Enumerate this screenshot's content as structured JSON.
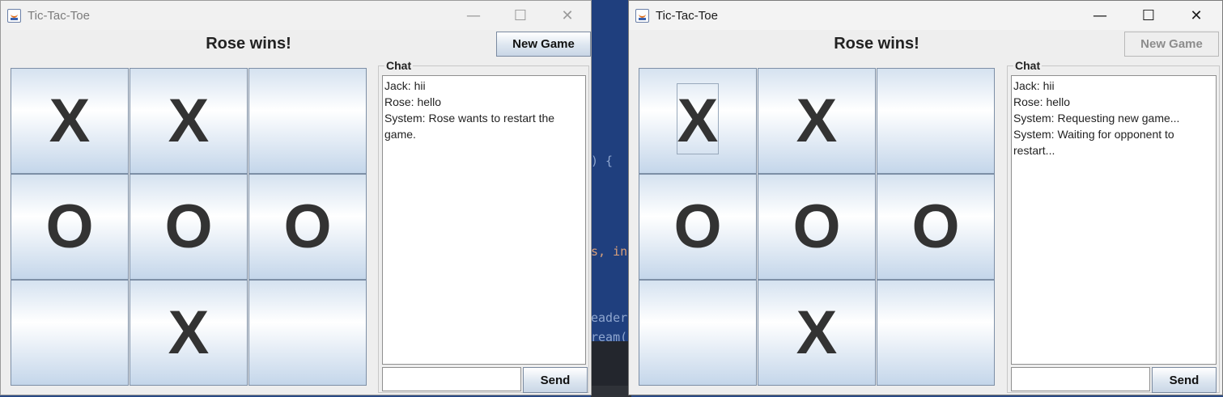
{
  "background_code": {
    "fragments": [
      ") { ",
      "s, in",
      "eader",
      "ream("
    ]
  },
  "windows": [
    {
      "title": "Tic-Tac-Toe",
      "status": "Rose wins!",
      "new_game_label": "New Game",
      "new_game_enabled": true,
      "board": [
        "X",
        "X",
        "",
        "O",
        "O",
        "O",
        "",
        "X",
        ""
      ],
      "chat_title": "Chat",
      "messages": [
        "Jack: hii",
        "Rose: hello",
        "System: Rose wants to restart the game."
      ],
      "input_value": "",
      "send_label": "Send",
      "controls": {
        "minimize": "—",
        "maximize": "☐",
        "close": "✕"
      }
    },
    {
      "title": "Tic-Tac-Toe",
      "status": "Rose wins!",
      "new_game_label": "New Game",
      "new_game_enabled": false,
      "board": [
        "X",
        "X",
        "",
        "O",
        "O",
        "O",
        "",
        "X",
        ""
      ],
      "chat_title": "Chat",
      "messages": [
        "Jack: hii",
        "Rose: hello",
        "System: Requesting new game...",
        "System: Waiting for opponent to restart..."
      ],
      "input_value": "",
      "send_label": "Send",
      "controls": {
        "minimize": "—",
        "maximize": "☐",
        "close": "✕"
      }
    }
  ]
}
